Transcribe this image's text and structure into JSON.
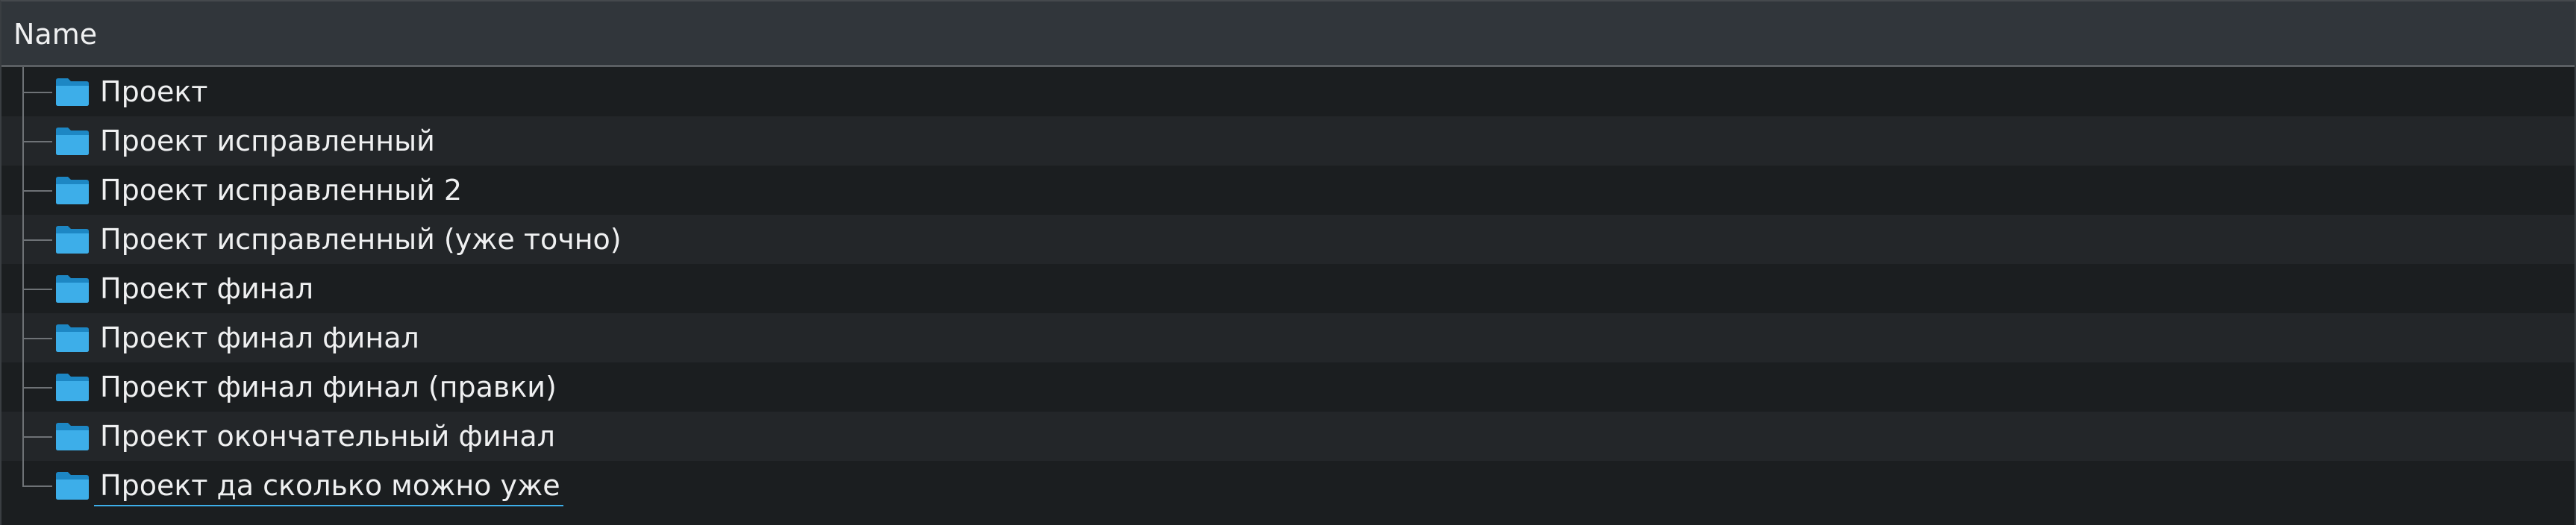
{
  "header": {
    "name_label": "Name"
  },
  "tree": {
    "items": [
      {
        "label": "Проект",
        "icon": "folder-icon"
      },
      {
        "label": "Проект исправленный",
        "icon": "folder-icon"
      },
      {
        "label": "Проект исправленный 2",
        "icon": "folder-icon"
      },
      {
        "label": "Проект исправленный (уже точно)",
        "icon": "folder-icon"
      },
      {
        "label": "Проект финал",
        "icon": "folder-icon"
      },
      {
        "label": "Проект финал финал",
        "icon": "folder-icon"
      },
      {
        "label": "Проект финал финал (правки)",
        "icon": "folder-icon"
      },
      {
        "label": "Проект окончательный финал",
        "icon": "folder-icon"
      },
      {
        "label": "Проект да сколько можно уже",
        "icon": "folder-icon"
      }
    ]
  },
  "colors": {
    "background": "#1b1e20",
    "alternate_row": "#232629",
    "header": "#31363b",
    "text": "#eff0f1",
    "folder": "#3daee9",
    "focus_underline": "#3daee9"
  }
}
